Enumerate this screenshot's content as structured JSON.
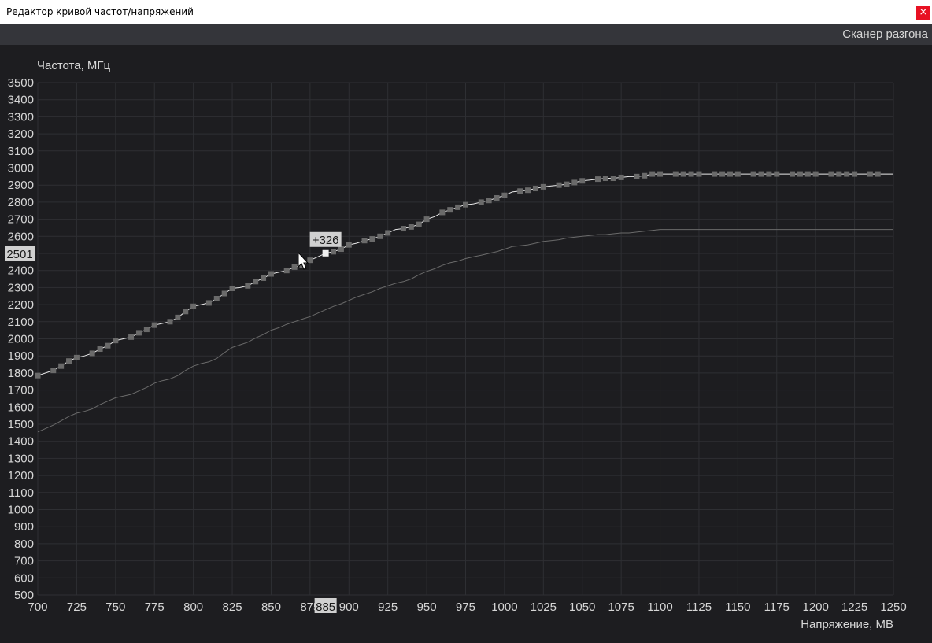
{
  "window": {
    "title": "Редактор кривой частот/напряжений",
    "close_icon": "close-icon",
    "close_label": "×",
    "close_color": "#e81123"
  },
  "toolbar": {
    "scanner_label": "Сканер разгона"
  },
  "chart_data": {
    "type": "line",
    "ylabel": "Частота, МГц",
    "xlabel": "Напряжение, МВ",
    "xlim": [
      700,
      1250
    ],
    "ylim": [
      500,
      3500
    ],
    "x_ticks": [
      "700",
      "725",
      "750",
      "775",
      "800",
      "825",
      "850",
      "875",
      "900",
      "925",
      "950",
      "975",
      "1000",
      "1025",
      "1050",
      "1075",
      "1100",
      "1125",
      "1150",
      "1175",
      "1200",
      "1225",
      "1250"
    ],
    "y_ticks": [
      "500",
      "600",
      "700",
      "800",
      "900",
      "1000",
      "1100",
      "1200",
      "1300",
      "1400",
      "1500",
      "1600",
      "1700",
      "1800",
      "1900",
      "2000",
      "2100",
      "2200",
      "2300",
      "2400",
      "2500",
      "2600",
      "2700",
      "2800",
      "2900",
      "3000",
      "3100",
      "3200",
      "3300",
      "3400",
      "3500"
    ],
    "grid": true,
    "colors": {
      "background": "#1d1d20",
      "grid": "#2e2f33",
      "curve": "#e8e8e8",
      "points": "#6a6a6a",
      "selected_point": "#f0f0f0",
      "default_curve": "#6a6a6a",
      "text": "#d6d6d6"
    },
    "selection": {
      "x": 885,
      "y": 2501,
      "offset_label": "+326",
      "x_readout": "885",
      "y_readout": "2501"
    },
    "series": [
      {
        "role": "edited",
        "x": [
          700,
          705,
          710,
          715,
          720,
          725,
          730,
          735,
          740,
          745,
          750,
          755,
          760,
          765,
          770,
          775,
          780,
          785,
          790,
          795,
          800,
          805,
          810,
          815,
          820,
          825,
          830,
          835,
          840,
          845,
          850,
          855,
          860,
          865,
          870,
          875,
          880,
          885,
          890,
          895,
          900,
          905,
          910,
          915,
          920,
          925,
          930,
          935,
          940,
          945,
          950,
          955,
          960,
          965,
          970,
          975,
          980,
          985,
          990,
          995,
          1000,
          1005,
          1010,
          1015,
          1020,
          1025,
          1030,
          1035,
          1040,
          1045,
          1050,
          1055,
          1060,
          1065,
          1070,
          1075,
          1080,
          1085,
          1090,
          1095,
          1100,
          1105,
          1110,
          1115,
          1120,
          1125,
          1130,
          1135,
          1140,
          1145,
          1150,
          1155,
          1160,
          1165,
          1170,
          1175,
          1180,
          1185,
          1190,
          1195,
          1200,
          1205,
          1210,
          1215,
          1220,
          1225,
          1230,
          1235,
          1240,
          1245,
          1250
        ],
        "y": [
          1785,
          1800,
          1815,
          1840,
          1870,
          1890,
          1900,
          1915,
          1940,
          1960,
          1990,
          2000,
          2010,
          2035,
          2055,
          2080,
          2090,
          2100,
          2125,
          2160,
          2190,
          2200,
          2210,
          2235,
          2265,
          2295,
          2300,
          2310,
          2335,
          2355,
          2380,
          2390,
          2400,
          2420,
          2430,
          2460,
          2480,
          2501,
          2510,
          2525,
          2550,
          2560,
          2575,
          2585,
          2600,
          2620,
          2640,
          2645,
          2655,
          2670,
          2700,
          2715,
          2740,
          2755,
          2770,
          2785,
          2790,
          2800,
          2810,
          2825,
          2840,
          2860,
          2865,
          2870,
          2880,
          2890,
          2895,
          2900,
          2905,
          2915,
          2925,
          2930,
          2935,
          2940,
          2940,
          2945,
          2950,
          2950,
          2955,
          2965,
          2965,
          2965,
          2965,
          2965,
          2965,
          2965,
          2965,
          2965,
          2965,
          2965,
          2965,
          2965,
          2965,
          2965,
          2965,
          2965,
          2965,
          2965,
          2965,
          2965,
          2965,
          2965,
          2965,
          2965,
          2965,
          2965,
          2965,
          2965,
          2965,
          2965,
          2965
        ],
        "points_x": [
          700,
          710,
          715,
          720,
          725,
          735,
          740,
          745,
          750,
          760,
          765,
          770,
          775,
          785,
          790,
          795,
          800,
          810,
          815,
          820,
          825,
          835,
          840,
          845,
          850,
          860,
          865,
          870,
          875,
          885,
          890,
          895,
          900,
          910,
          915,
          920,
          925,
          935,
          940,
          945,
          950,
          960,
          965,
          970,
          975,
          985,
          990,
          995,
          1000,
          1010,
          1015,
          1020,
          1025,
          1035,
          1040,
          1045,
          1050,
          1060,
          1065,
          1070,
          1075,
          1085,
          1090,
          1095,
          1100,
          1110,
          1115,
          1120,
          1125,
          1135,
          1140,
          1145,
          1150,
          1160,
          1165,
          1170,
          1175,
          1185,
          1190,
          1195,
          1200,
          1210,
          1215,
          1220,
          1225,
          1235,
          1240
        ]
      },
      {
        "role": "default",
        "x": [
          700,
          705,
          710,
          715,
          720,
          725,
          730,
          735,
          740,
          745,
          750,
          755,
          760,
          765,
          770,
          775,
          780,
          785,
          790,
          795,
          800,
          805,
          810,
          815,
          820,
          825,
          830,
          835,
          840,
          845,
          850,
          855,
          860,
          865,
          870,
          875,
          880,
          885,
          890,
          895,
          900,
          905,
          910,
          915,
          920,
          925,
          930,
          935,
          940,
          945,
          950,
          955,
          960,
          965,
          970,
          975,
          980,
          985,
          990,
          995,
          1000,
          1005,
          1010,
          1015,
          1020,
          1025,
          1030,
          1035,
          1040,
          1045,
          1050,
          1055,
          1060,
          1065,
          1070,
          1075,
          1080,
          1085,
          1090,
          1095,
          1100,
          1250
        ],
        "y": [
          1455,
          1475,
          1495,
          1520,
          1545,
          1565,
          1575,
          1590,
          1615,
          1635,
          1655,
          1665,
          1675,
          1695,
          1715,
          1740,
          1755,
          1765,
          1785,
          1815,
          1840,
          1855,
          1865,
          1885,
          1920,
          1950,
          1965,
          1980,
          2005,
          2025,
          2050,
          2065,
          2085,
          2100,
          2115,
          2130,
          2150,
          2170,
          2190,
          2205,
          2225,
          2245,
          2260,
          2275,
          2295,
          2310,
          2325,
          2335,
          2350,
          2375,
          2395,
          2410,
          2430,
          2445,
          2455,
          2470,
          2480,
          2490,
          2500,
          2510,
          2525,
          2540,
          2545,
          2550,
          2560,
          2570,
          2575,
          2580,
          2590,
          2595,
          2600,
          2605,
          2610,
          2610,
          2615,
          2620,
          2620,
          2625,
          2630,
          2635,
          2640,
          2640
        ]
      }
    ]
  }
}
